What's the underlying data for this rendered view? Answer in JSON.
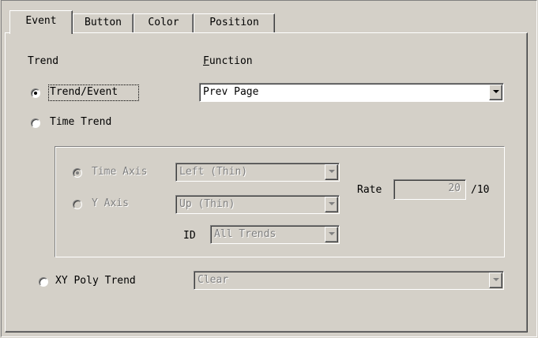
{
  "tabs": [
    {
      "label": "Event",
      "active": true
    },
    {
      "label": "Button",
      "active": false
    },
    {
      "label": "Color",
      "active": false
    },
    {
      "label": "Position",
      "active": false
    }
  ],
  "trend_section": {
    "heading": "Trend",
    "options": [
      {
        "label": "Trend/Event",
        "selected": true,
        "enabled": true
      },
      {
        "label": "Time Trend",
        "selected": false,
        "enabled": true
      },
      {
        "label": "XY Poly Trend",
        "selected": false,
        "enabled": true
      }
    ]
  },
  "function_section": {
    "heading_first": "F",
    "heading_rest": "unction",
    "selected": "Prev Page"
  },
  "time_trend_group": {
    "time_axis_label": "Time Axis",
    "time_axis_value": "Left (Thin)",
    "y_axis_label": "Y Axis",
    "y_axis_value": "Up (Thin)",
    "id_label": "ID",
    "id_value": "All Trends",
    "rate_label": "Rate",
    "rate_value": "20",
    "rate_unit": "/10"
  },
  "xy_poly": {
    "value": "Clear"
  }
}
